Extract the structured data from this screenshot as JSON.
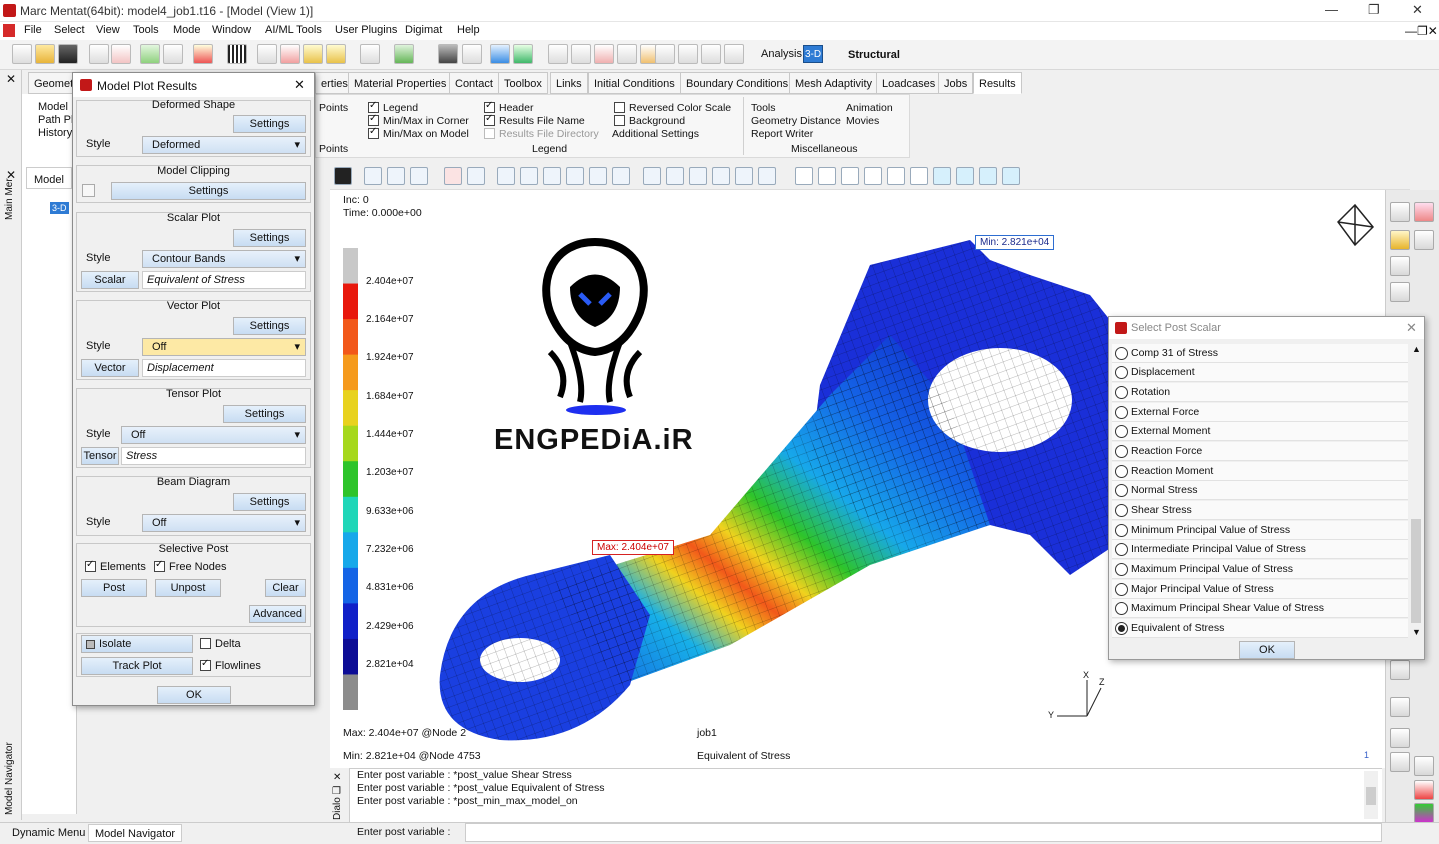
{
  "window": {
    "title": "Marc Mentat(64bit): model4_job1.t16  -  [Model (View 1)]"
  },
  "menu": [
    "File",
    "Select",
    "View",
    "Tools",
    "Mode",
    "Window",
    "AI/ML Tools",
    "User Plugins",
    "Digimat",
    "Help"
  ],
  "toolbar": {
    "analysis_label": "Analysis",
    "analysis_mode": "3-D",
    "analysis_type": "Structural"
  },
  "tabs": [
    "Geometr",
    "erties",
    "Material Properties",
    "Contact",
    "Toolbox",
    "Links",
    "Initial Conditions",
    "Boundary Conditions",
    "Mesh Adaptivity",
    "Loadcases",
    "Jobs",
    "Results"
  ],
  "ribbon": {
    "points1": "Points",
    "points2": "Points",
    "legend_group": "Legend",
    "legend_items": [
      {
        "label": "Legend",
        "checked": true
      },
      {
        "label": "Min/Max in Corner",
        "checked": true
      },
      {
        "label": "Min/Max on Model",
        "checked": true
      }
    ],
    "header_items": [
      {
        "label": "Header",
        "checked": true
      },
      {
        "label": "Results File Name",
        "checked": true
      },
      {
        "label": "Results File Directory",
        "checked": false
      }
    ],
    "scale_items": [
      {
        "label": "Reversed Color Scale",
        "checked": false
      },
      {
        "label": "Background",
        "checked": false
      },
      {
        "label": "Additional Settings"
      }
    ],
    "misc_group": "Miscellaneous",
    "misc_items": [
      "Tools",
      "Animation",
      "Geometry Distance",
      "Movies",
      "Report Writer"
    ]
  },
  "left": {
    "main_menu": "Main Mer",
    "model_tab": "Model",
    "tree_root": "3-D",
    "items": [
      "Model I",
      "Path Pl",
      "History"
    ],
    "navigator": "Model Navigator"
  },
  "dialog": {
    "title": "Model Plot Results",
    "deformed": {
      "title": "Deformed Shape",
      "settings": "Settings",
      "style_label": "Style",
      "style": "Deformed"
    },
    "clipping": {
      "title": "Model Clipping",
      "settings": "Settings"
    },
    "scalar": {
      "title": "Scalar Plot",
      "settings": "Settings",
      "style_label": "Style",
      "style": "Contour Bands",
      "btn": "Scalar",
      "value": "Equivalent of Stress"
    },
    "vector": {
      "title": "Vector Plot",
      "settings": "Settings",
      "style_label": "Style",
      "style": "Off",
      "btn": "Vector",
      "value": "Displacement"
    },
    "tensor": {
      "title": "Tensor Plot",
      "settings": "Settings",
      "style_label": "Style",
      "style": "Off",
      "btn": "Tensor",
      "value": "Stress"
    },
    "beam": {
      "title": "Beam Diagram",
      "settings": "Settings",
      "style_label": "Style",
      "style": "Off"
    },
    "selective": {
      "title": "Selective Post",
      "elements": "Elements",
      "free_nodes": "Free Nodes",
      "post": "Post",
      "unpost": "Unpost",
      "clear": "Clear",
      "advanced": "Advanced"
    },
    "isolate": "Isolate",
    "delta": "Delta",
    "track": "Track Plot",
    "flowlines": "Flowlines",
    "ok": "OK"
  },
  "viewport": {
    "inc": "Inc:  0",
    "time": "Time:  0.000e+00",
    "legend": [
      "2.404e+07",
      "2.164e+07",
      "1.924e+07",
      "1.684e+07",
      "1.444e+07",
      "1.203e+07",
      "9.633e+06",
      "7.232e+06",
      "4.831e+06",
      "2.429e+06",
      "2.821e+04"
    ],
    "legend_colors": [
      "#c8c8c8",
      "#e8180c",
      "#f2581a",
      "#f59a1c",
      "#e8d21e",
      "#a6d81c",
      "#2ec42a",
      "#1fd6b8",
      "#17a8ea",
      "#1464e6",
      "#1020c8",
      "#0d0d96",
      "#8c8c8c"
    ],
    "max_label": "Max:  2.404e+07",
    "min_label": "Min:  2.821e+04",
    "footer_max": "Max:  2.404e+07 @Node  2",
    "footer_min": "Min:  2.821e+04 @Node  4753",
    "job": "job1",
    "scalar": "Equivalent of Stress",
    "page": "1",
    "watermark": "ENGPEDiA.iR",
    "axes": [
      "X",
      "Y",
      "Z"
    ]
  },
  "select_post_scalar": {
    "title": "Select Post Scalar",
    "options": [
      "Comp 31 of Stress",
      "Displacement",
      "Rotation",
      "External Force",
      "External Moment",
      "Reaction Force",
      "Reaction Moment",
      "Normal Stress",
      "Shear Stress",
      "Minimum Principal Value of Stress",
      "Intermediate Principal Value of Stress",
      "Maximum Principal Value of Stress",
      "Major Principal Value of Stress",
      "Maximum Principal Shear Value of Stress",
      "Equivalent of Stress"
    ],
    "selected": "Equivalent of Stress",
    "ok": "OK"
  },
  "console": {
    "lines": [
      "Enter post variable : *post_value Shear Stress",
      "Enter post variable : *post_value Equivalent of Stress",
      "Enter post variable : *post_min_max_model_on"
    ],
    "prompt": "Enter post variable :",
    "side": "Dialo"
  },
  "bottom_tabs": [
    "Dynamic Menu",
    "Model Navigator"
  ]
}
